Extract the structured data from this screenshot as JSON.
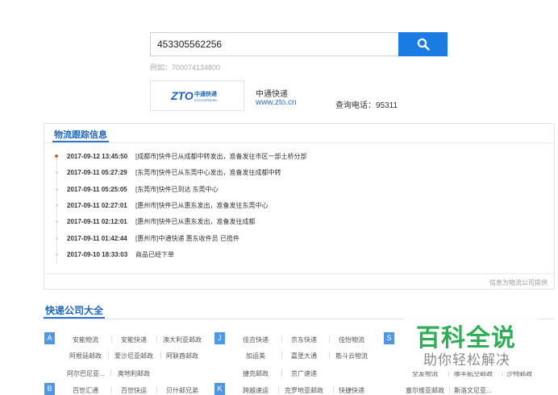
{
  "search": {
    "value": "453305562256",
    "example": "例如：700074134800"
  },
  "company": {
    "logo_text": "ZTO",
    "logo_cn": "中通快递",
    "logo_en": "ZTO EXPRESS",
    "name": "中通快递",
    "url": "www.zto.cn",
    "phone": "查询电话：95311"
  },
  "tracking": {
    "title": "物流跟踪信息",
    "source": "信息为物流公司提供",
    "events": [
      {
        "time": "2017-09-12 13:45:50",
        "desc": "[成都市]快件已从成都中转发出，准备发往市区一部土桥分部"
      },
      {
        "time": "2017-09-11 05:27:29",
        "desc": "[东莞市]快件已从东莞中心发出，准备发往成都中转"
      },
      {
        "time": "2017-09-11 05:25:05",
        "desc": "[东莞市]快件已到达 东莞中心"
      },
      {
        "time": "2017-09-11 02:27:01",
        "desc": "[惠州市]快件已从惠东发出，准备发往东莞中心"
      },
      {
        "time": "2017-09-11 02:12:01",
        "desc": "[惠州市]快件已从惠东发出，准备发往成都"
      },
      {
        "time": "2017-09-11 01:42:44",
        "desc": "[惠州市]中通快递 惠东收件员 已揽件"
      },
      {
        "time": "2017-09-10 18:33:03",
        "desc": "商品已经下单"
      }
    ]
  },
  "directory": {
    "title": "快递公司大全",
    "letters": [
      "A",
      "J",
      "S",
      "B",
      "K"
    ],
    "group_a": {
      "row1": [
        "安能物流",
        "安能快递",
        "澳大利亚邮政"
      ],
      "row2": [
        "阿根廷邮政",
        "爱沙尼亚邮政",
        "阿联酋邮政"
      ],
      "row3": [
        "阿尔巴尼亚...",
        "奥地利邮政"
      ]
    },
    "group_j": {
      "row1": [
        "佳吉快递",
        "京东快递",
        "佳怡物流"
      ],
      "row2": [
        "加运美",
        "嘉里大通",
        "筋斗云物流"
      ],
      "row3": [
        "捷克邮政",
        "京广速递"
      ]
    },
    "group_s": {
      "row3": [
        "全友物流",
        "顺丰航空邮政",
        "沙特邮政"
      ]
    },
    "group_b": {
      "row4": [
        "百世汇通",
        "百世快运",
        "贝什邮兄弟"
      ]
    },
    "group_k": {
      "row4": [
        "跨越速运",
        "克罗地亚邮政",
        "快捷快递"
      ]
    },
    "group_s2": {
      "row4": [
        "塞尔维亚邮政",
        "斯洛文尼亚..."
      ]
    }
  },
  "watermark": {
    "main": "百科全说",
    "sub": "助你轻松解决"
  },
  "colors": {
    "accent": "#1a7be3",
    "link": "#2266bb",
    "active_dot": "#e6552f",
    "watermark": "#2fae56"
  }
}
